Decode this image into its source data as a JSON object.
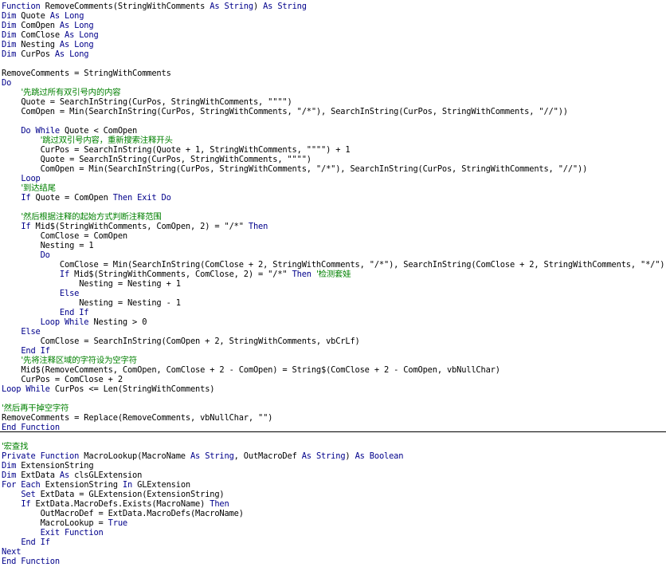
{
  "colors": {
    "keyword": "#00008b",
    "comment": "#008000",
    "text": "#000000",
    "background": "#ffffff",
    "separator": "#000000"
  },
  "lines": [
    {
      "indent": "",
      "tokens": [
        {
          "t": "Function",
          "c": "kw"
        },
        {
          "t": " RemoveComments(StringWithComments ",
          "c": ""
        },
        {
          "t": "As String",
          "c": "kw"
        },
        {
          "t": ") ",
          "c": ""
        },
        {
          "t": "As String",
          "c": "kw"
        }
      ]
    },
    {
      "indent": "",
      "tokens": [
        {
          "t": "Dim",
          "c": "kw"
        },
        {
          "t": " Quote ",
          "c": ""
        },
        {
          "t": "As Long",
          "c": "kw"
        }
      ]
    },
    {
      "indent": "",
      "tokens": [
        {
          "t": "Dim",
          "c": "kw"
        },
        {
          "t": " ComOpen ",
          "c": ""
        },
        {
          "t": "As Long",
          "c": "kw"
        }
      ]
    },
    {
      "indent": "",
      "tokens": [
        {
          "t": "Dim",
          "c": "kw"
        },
        {
          "t": " ComClose ",
          "c": ""
        },
        {
          "t": "As Long",
          "c": "kw"
        }
      ]
    },
    {
      "indent": "",
      "tokens": [
        {
          "t": "Dim",
          "c": "kw"
        },
        {
          "t": " Nesting ",
          "c": ""
        },
        {
          "t": "As Long",
          "c": "kw"
        }
      ]
    },
    {
      "indent": "",
      "tokens": [
        {
          "t": "Dim",
          "c": "kw"
        },
        {
          "t": " CurPos ",
          "c": ""
        },
        {
          "t": "As Long",
          "c": "kw"
        }
      ]
    },
    {
      "indent": "",
      "tokens": []
    },
    {
      "indent": "",
      "tokens": [
        {
          "t": "RemoveComments = StringWithComments",
          "c": ""
        }
      ]
    },
    {
      "indent": "",
      "tokens": [
        {
          "t": "Do",
          "c": "kw"
        }
      ]
    },
    {
      "indent": "    ",
      "tokens": [
        {
          "t": "'先跳过所有双引号内的内容",
          "c": "cm"
        }
      ]
    },
    {
      "indent": "    ",
      "tokens": [
        {
          "t": "Quote = SearchInString(CurPos, StringWithComments, \"\"\"\")",
          "c": ""
        }
      ]
    },
    {
      "indent": "    ",
      "tokens": [
        {
          "t": "ComOpen = Min(SearchInString(CurPos, StringWithComments, \"/*\"), SearchInString(CurPos, StringWithComments, \"//\"))",
          "c": ""
        }
      ]
    },
    {
      "indent": "",
      "tokens": []
    },
    {
      "indent": "    ",
      "tokens": [
        {
          "t": "Do While",
          "c": "kw"
        },
        {
          "t": " Quote < ComOpen",
          "c": ""
        }
      ]
    },
    {
      "indent": "        ",
      "tokens": [
        {
          "t": "'跳过双引号内容，重新搜索注释开头",
          "c": "cm"
        }
      ]
    },
    {
      "indent": "        ",
      "tokens": [
        {
          "t": "CurPos = SearchInString(Quote + 1, StringWithComments, \"\"\"\") + 1",
          "c": ""
        }
      ]
    },
    {
      "indent": "        ",
      "tokens": [
        {
          "t": "Quote = SearchInString(CurPos, StringWithComments, \"\"\"\")",
          "c": ""
        }
      ]
    },
    {
      "indent": "        ",
      "tokens": [
        {
          "t": "ComOpen = Min(SearchInString(CurPos, StringWithComments, \"/*\"), SearchInString(CurPos, StringWithComments, \"//\"))",
          "c": ""
        }
      ]
    },
    {
      "indent": "    ",
      "tokens": [
        {
          "t": "Loop",
          "c": "kw"
        }
      ]
    },
    {
      "indent": "    ",
      "tokens": [
        {
          "t": "'到达结尾",
          "c": "cm"
        }
      ]
    },
    {
      "indent": "    ",
      "tokens": [
        {
          "t": "If",
          "c": "kw"
        },
        {
          "t": " Quote = ComOpen ",
          "c": ""
        },
        {
          "t": "Then Exit Do",
          "c": "kw"
        }
      ]
    },
    {
      "indent": "",
      "tokens": []
    },
    {
      "indent": "    ",
      "tokens": [
        {
          "t": "'然后根据注释的起始方式判断注释范围",
          "c": "cm"
        }
      ]
    },
    {
      "indent": "    ",
      "tokens": [
        {
          "t": "If",
          "c": "kw"
        },
        {
          "t": " Mid$(StringWithComments, ComOpen, 2) = \"/*\" ",
          "c": ""
        },
        {
          "t": "Then",
          "c": "kw"
        }
      ]
    },
    {
      "indent": "        ",
      "tokens": [
        {
          "t": "ComClose = ComOpen",
          "c": ""
        }
      ]
    },
    {
      "indent": "        ",
      "tokens": [
        {
          "t": "Nesting = 1",
          "c": ""
        }
      ]
    },
    {
      "indent": "        ",
      "tokens": [
        {
          "t": "Do",
          "c": "kw"
        }
      ]
    },
    {
      "indent": "            ",
      "tokens": [
        {
          "t": "ComClose = Min(SearchInString(ComClose + 2, StringWithComments, \"/*\"), SearchInString(ComClose + 2, StringWithComments, \"*/\"))",
          "c": ""
        }
      ]
    },
    {
      "indent": "            ",
      "tokens": [
        {
          "t": "If",
          "c": "kw"
        },
        {
          "t": " Mid$(StringWithComments, ComClose, 2) = \"/*\" ",
          "c": ""
        },
        {
          "t": "Then",
          "c": "kw"
        },
        {
          "t": " ",
          "c": ""
        },
        {
          "t": "'检测套娃",
          "c": "cm"
        }
      ]
    },
    {
      "indent": "                ",
      "tokens": [
        {
          "t": "Nesting = Nesting + 1",
          "c": ""
        }
      ]
    },
    {
      "indent": "            ",
      "tokens": [
        {
          "t": "Else",
          "c": "kw"
        }
      ]
    },
    {
      "indent": "                ",
      "tokens": [
        {
          "t": "Nesting = Nesting - 1",
          "c": ""
        }
      ]
    },
    {
      "indent": "            ",
      "tokens": [
        {
          "t": "End If",
          "c": "kw"
        }
      ]
    },
    {
      "indent": "        ",
      "tokens": [
        {
          "t": "Loop While",
          "c": "kw"
        },
        {
          "t": " Nesting > 0",
          "c": ""
        }
      ]
    },
    {
      "indent": "    ",
      "tokens": [
        {
          "t": "Else",
          "c": "kw"
        }
      ]
    },
    {
      "indent": "        ",
      "tokens": [
        {
          "t": "ComClose = SearchInString(ComOpen + 2, StringWithComments, vbCrLf)",
          "c": ""
        }
      ]
    },
    {
      "indent": "    ",
      "tokens": [
        {
          "t": "End If",
          "c": "kw"
        }
      ]
    },
    {
      "indent": "    ",
      "tokens": [
        {
          "t": "'先将注释区域的字符设为空字符",
          "c": "cm"
        }
      ]
    },
    {
      "indent": "    ",
      "tokens": [
        {
          "t": "Mid$(RemoveComments, ComOpen, ComClose + 2 - ComOpen) = String$(ComClose + 2 - ComOpen, vbNullChar)",
          "c": ""
        }
      ]
    },
    {
      "indent": "    ",
      "tokens": [
        {
          "t": "CurPos = ComClose + 2",
          "c": ""
        }
      ]
    },
    {
      "indent": "",
      "tokens": [
        {
          "t": "Loop While",
          "c": "kw"
        },
        {
          "t": " CurPos <= Len(StringWithComments)",
          "c": ""
        }
      ]
    },
    {
      "indent": "",
      "tokens": []
    },
    {
      "indent": "",
      "tokens": [
        {
          "t": "'然后再干掉空字符",
          "c": "cm"
        }
      ]
    },
    {
      "indent": "",
      "tokens": [
        {
          "t": "RemoveComments = Replace(RemoveComments, vbNullChar, \"\")",
          "c": ""
        }
      ]
    },
    {
      "indent": "",
      "tokens": [
        {
          "t": "End Function",
          "c": "kw"
        }
      ]
    },
    {
      "indent": "",
      "tokens": []
    },
    {
      "indent": "",
      "tokens": [
        {
          "t": "'宏查找",
          "c": "cm"
        }
      ]
    },
    {
      "indent": "",
      "tokens": [
        {
          "t": "Private Function",
          "c": "kw"
        },
        {
          "t": " MacroLookup(MacroName ",
          "c": ""
        },
        {
          "t": "As String",
          "c": "kw"
        },
        {
          "t": ", OutMacroDef ",
          "c": ""
        },
        {
          "t": "As String",
          "c": "kw"
        },
        {
          "t": ") ",
          "c": ""
        },
        {
          "t": "As Boolean",
          "c": "kw"
        }
      ]
    },
    {
      "indent": "",
      "tokens": [
        {
          "t": "Dim",
          "c": "kw"
        },
        {
          "t": " ExtensionString",
          "c": ""
        }
      ]
    },
    {
      "indent": "",
      "tokens": [
        {
          "t": "Dim",
          "c": "kw"
        },
        {
          "t": " ExtData ",
          "c": ""
        },
        {
          "t": "As",
          "c": "kw"
        },
        {
          "t": " clsGLExtension",
          "c": ""
        }
      ]
    },
    {
      "indent": "",
      "tokens": [
        {
          "t": "For Each",
          "c": "kw"
        },
        {
          "t": " ExtensionString ",
          "c": ""
        },
        {
          "t": "In",
          "c": "kw"
        },
        {
          "t": " GLExtension",
          "c": ""
        }
      ]
    },
    {
      "indent": "    ",
      "tokens": [
        {
          "t": "Set",
          "c": "kw"
        },
        {
          "t": " ExtData = GLExtension(ExtensionString)",
          "c": ""
        }
      ]
    },
    {
      "indent": "    ",
      "tokens": [
        {
          "t": "If",
          "c": "kw"
        },
        {
          "t": " ExtData.MacroDefs.Exists(MacroName) ",
          "c": ""
        },
        {
          "t": "Then",
          "c": "kw"
        }
      ]
    },
    {
      "indent": "        ",
      "tokens": [
        {
          "t": "OutMacroDef = ExtData.MacroDefs(MacroName)",
          "c": ""
        }
      ]
    },
    {
      "indent": "        ",
      "tokens": [
        {
          "t": "MacroLookup = ",
          "c": ""
        },
        {
          "t": "True",
          "c": "kw"
        }
      ]
    },
    {
      "indent": "        ",
      "tokens": [
        {
          "t": "Exit Function",
          "c": "kw"
        }
      ]
    },
    {
      "indent": "    ",
      "tokens": [
        {
          "t": "End If",
          "c": "kw"
        }
      ]
    },
    {
      "indent": "",
      "tokens": [
        {
          "t": "Next",
          "c": "kw"
        }
      ]
    },
    {
      "indent": "",
      "tokens": [
        {
          "t": "End Function",
          "c": "kw"
        }
      ]
    }
  ]
}
